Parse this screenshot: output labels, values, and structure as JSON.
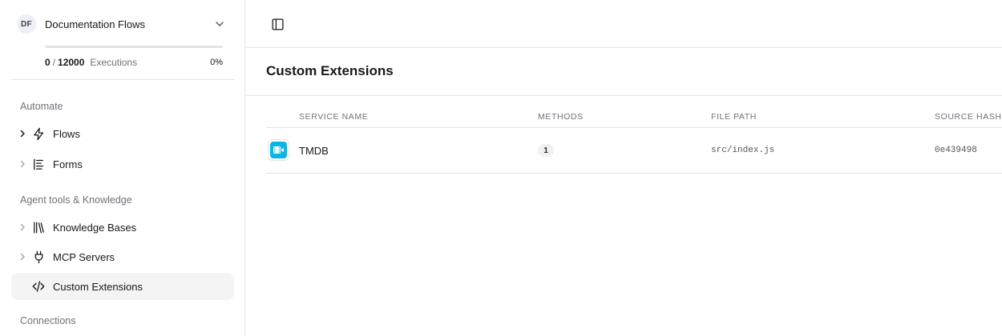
{
  "workspace": {
    "initials": "DF",
    "name": "Documentation Flows",
    "usage": {
      "used": "0",
      "separator": "/",
      "total": "12000",
      "label": "Executions",
      "percent_text": "0%",
      "fraction": 0
    }
  },
  "sidebar": {
    "sections": [
      {
        "title": "Automate",
        "items": [
          {
            "label": "Flows",
            "icon": "lightning-icon"
          },
          {
            "label": "Forms",
            "icon": "form-lines-icon"
          }
        ]
      },
      {
        "title": "Agent tools & Knowledge",
        "items": [
          {
            "label": "Knowledge Bases",
            "icon": "library-icon"
          },
          {
            "label": "MCP Servers",
            "icon": "plug-icon"
          },
          {
            "label": "Custom Extensions",
            "icon": "code-icon",
            "active": true
          }
        ]
      },
      {
        "title": "Connections",
        "items": []
      }
    ]
  },
  "main": {
    "title": "Custom Extensions",
    "table": {
      "headers": [
        "SERVICE NAME",
        "METHODS",
        "FILE PATH",
        "SOURCE HASH"
      ],
      "rows": [
        {
          "name": "TMDB",
          "icon": "film-icon",
          "methods": "1",
          "file_path": "src/index.js",
          "source_hash": "0e439498"
        }
      ]
    }
  },
  "colors": {
    "accent_tile": "#0ab4e6",
    "active_bg": "#f4f4f5",
    "border": "#e4e4e7",
    "muted_text": "#71717a"
  }
}
